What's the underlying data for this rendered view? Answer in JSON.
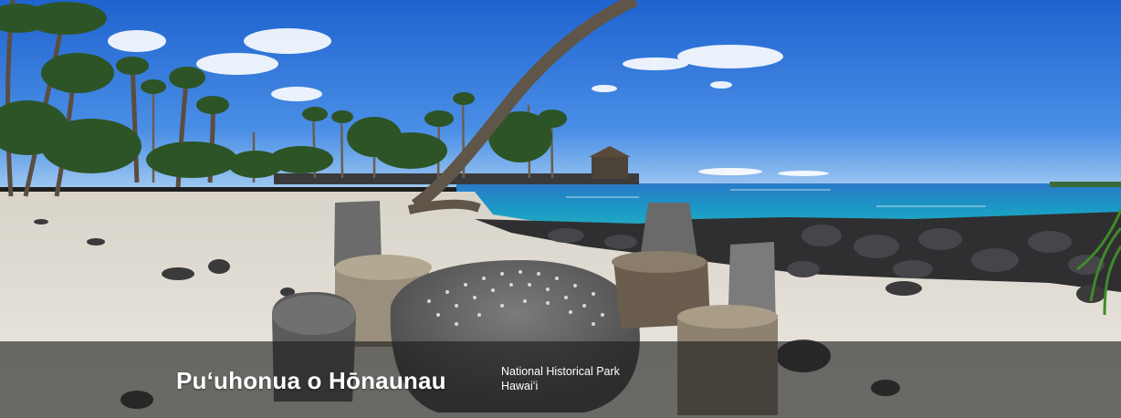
{
  "hero": {
    "park_name": "Puʻuhonua o Hōnaunau",
    "designation": "National Historical Park",
    "state": "Hawaiʻi"
  },
  "colors": {
    "sky_top": "#2b6fd6",
    "sky_bottom": "#7fb3ee",
    "ocean": "#1690b8",
    "sand": "#e6e1d8",
    "lava_rock": "#3a3a3c",
    "palm_green": "#2f5a2a",
    "title_band": "#1c1c1c"
  },
  "scene": {
    "icons": [
      "palm-tree-icon",
      "lava-rock-wall-icon",
      "stone-table-icon",
      "cloud-icon"
    ]
  }
}
